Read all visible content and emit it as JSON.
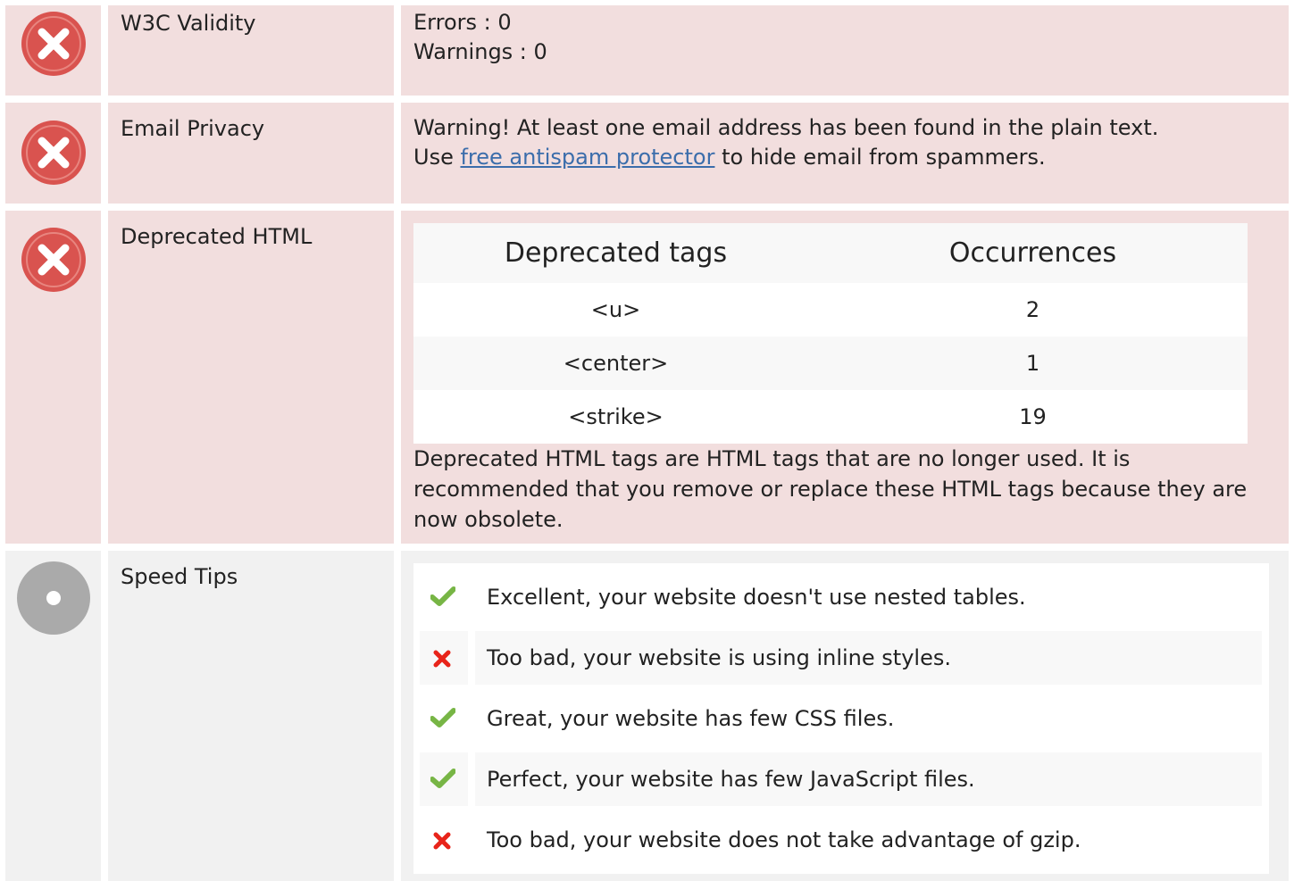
{
  "rows": {
    "w3c": {
      "label": "W3C Validity",
      "errors": "Errors : 0",
      "warnings": "Warnings : 0"
    },
    "email": {
      "label": "Email Privacy",
      "line1": "Warning! At least one email address has been found in the plain text.",
      "line2_prefix": "Use ",
      "link_text": "free antispam protector",
      "line2_suffix": " to hide email from spammers."
    },
    "deprecated": {
      "label": "Deprecated HTML",
      "table": {
        "headers": [
          "Deprecated tags",
          "Occurrences"
        ],
        "rows": [
          [
            "<u>",
            "2"
          ],
          [
            "<center>",
            "1"
          ],
          [
            "<strike>",
            "19"
          ]
        ]
      },
      "note": "Deprecated HTML tags are HTML tags that are no longer used. It is recommended that you remove or replace these HTML tags because they are now obsolete."
    },
    "speed": {
      "label": "Speed Tips",
      "tips": [
        {
          "status": "pass",
          "icon": "check-icon",
          "text": "Excellent, your website doesn't use nested tables."
        },
        {
          "status": "fail",
          "icon": "cross-icon",
          "text": "Too bad, your website is using inline styles."
        },
        {
          "status": "pass",
          "icon": "check-icon",
          "text": "Great, your website has few CSS files."
        },
        {
          "status": "pass",
          "icon": "check-icon",
          "text": "Perfect, your website has few JavaScript files."
        },
        {
          "status": "fail",
          "icon": "cross-icon",
          "text": "Too bad, your website does not take advantage of gzip."
        }
      ]
    }
  },
  "colors": {
    "bad_background": "#f2dede",
    "neutral_background": "#f1f1f1",
    "error_icon": "#d9534f",
    "neutral_icon": "#aaaaaa",
    "pass_check": "#77b545",
    "fail_cross": "#e8241a",
    "link": "#3b6dab"
  }
}
